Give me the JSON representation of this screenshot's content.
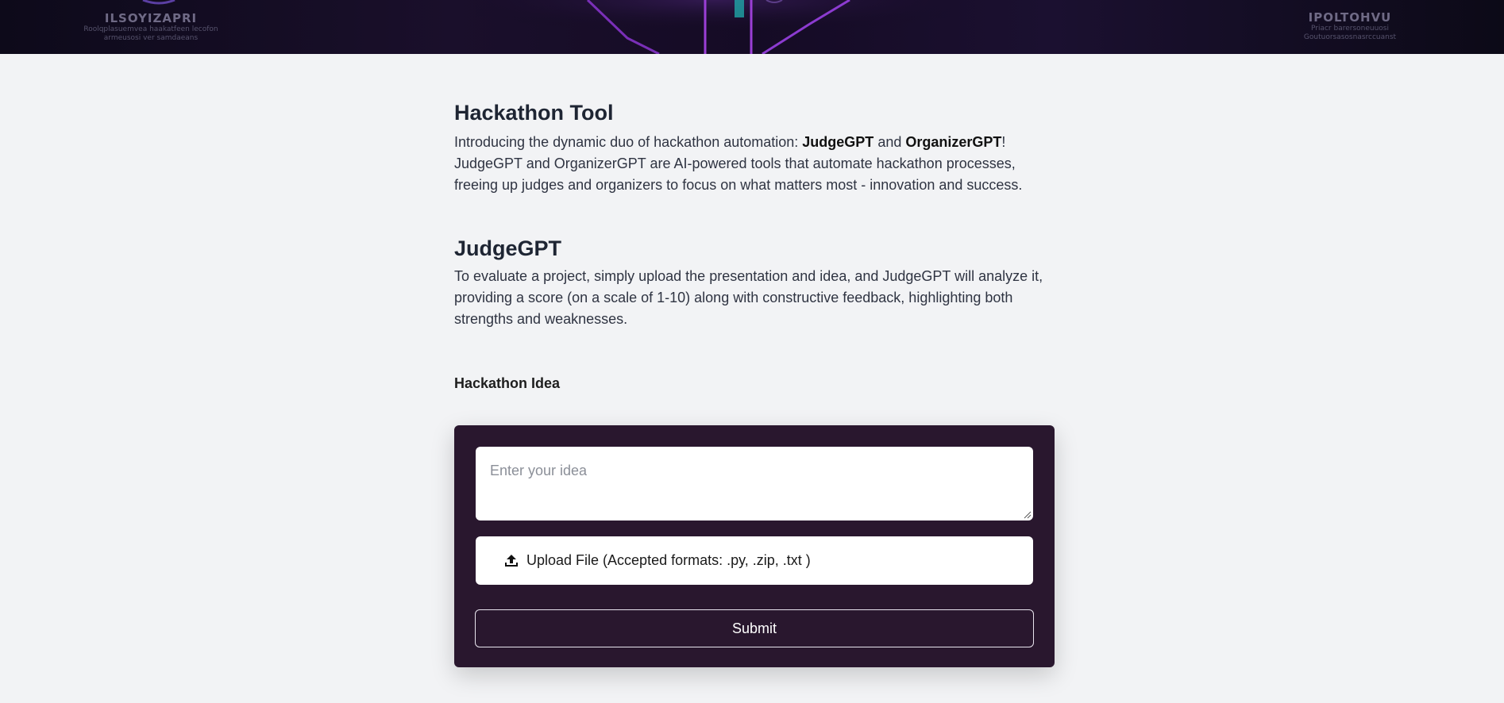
{
  "hero": {
    "left_title": "ILSOYIZAPRI",
    "left_sub1": "Roolqplasuemvea haakatfeen lecofon",
    "left_sub2": "armeusosi ver samdaeans",
    "right_title": "IPOLTOHVU",
    "right_sub1": "Priacr barersoneuuosi",
    "right_sub2": "Goutuorsasosnasrccuanst"
  },
  "intro": {
    "title": "Hackathon Tool",
    "text_before": "Introducing the dynamic duo of hackathon automation: ",
    "bold1": "JudgeGPT",
    "text_and": " and ",
    "bold2": "OrganizerGPT",
    "text_after": "! JudgeGPT and OrganizerGPT are AI-powered tools that automate hackathon processes, freeing up judges and organizers to focus on what matters most - innovation and success."
  },
  "judge": {
    "title": "JudgeGPT",
    "description": "To evaluate a project, simply upload the presentation and idea, and JudgeGPT will analyze it, providing a score (on a scale of 1-10) along with constructive feedback, highlighting both strengths and weaknesses."
  },
  "form": {
    "label": "Hackathon Idea",
    "idea_placeholder": "Enter your idea",
    "upload_label": "Upload File (Accepted formats: .py, .zip, .txt )",
    "upload_icon": "upload-icon",
    "submit_label": "Submit"
  },
  "colors": {
    "card_bg": "#29172e",
    "page_bg": "#f2f3f5"
  }
}
